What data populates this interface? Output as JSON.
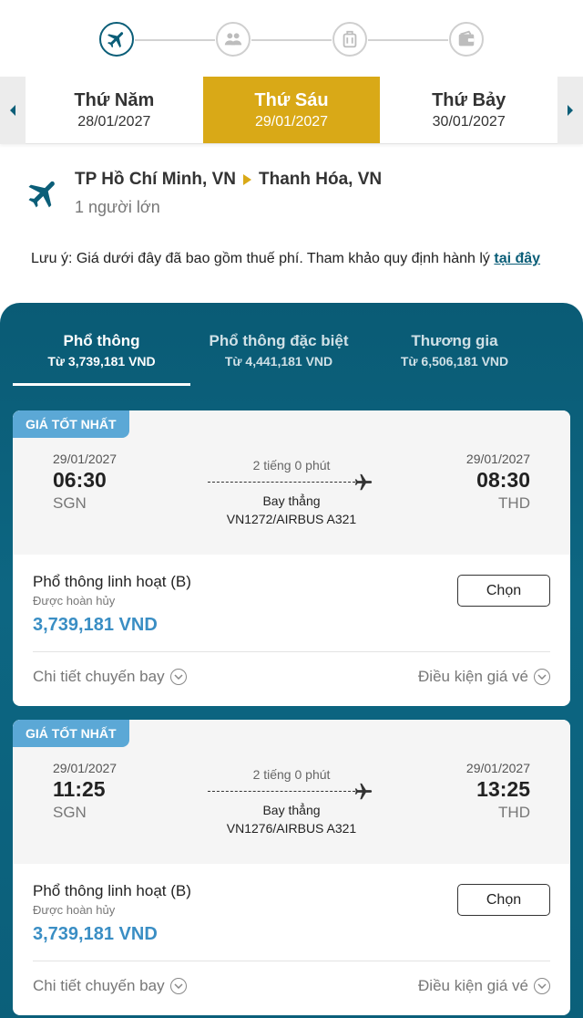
{
  "stepper": {
    "steps": [
      {
        "icon": "plane-icon",
        "state": "active"
      },
      {
        "icon": "passengers-icon",
        "state": "inactive"
      },
      {
        "icon": "baggage-icon",
        "state": "inactive"
      },
      {
        "icon": "wallet-icon",
        "state": "inactive"
      }
    ]
  },
  "dates": [
    {
      "day": "Thứ Năm",
      "date": "28/01/2027"
    },
    {
      "day": "Thứ Sáu",
      "date": "29/01/2027",
      "selected": true
    },
    {
      "day": "Thứ Bảy",
      "date": "30/01/2027"
    }
  ],
  "route": {
    "origin": "TP Hồ Chí Minh, VN",
    "destination": "Thanh Hóa, VN",
    "passengers": "1 người lớn"
  },
  "note": {
    "text": "Lưu ý: Giá dưới đây đã bao gồm thuế phí. Tham khảo quy định hành lý ",
    "link": "tại đây"
  },
  "tabs": [
    {
      "name": "Phổ thông",
      "price": "Từ 3,739,181 VND",
      "active": true
    },
    {
      "name": "Phổ thông đặc biệt",
      "price": "Từ 4,441,181 VND"
    },
    {
      "name": "Thương gia",
      "price": "Từ 6,506,181 VND"
    }
  ],
  "flights": [
    {
      "badge": "GIÁ TỐT NHẤT",
      "dep_date": "29/01/2027",
      "dep_time": "06:30",
      "dep_code": "SGN",
      "arr_date": "29/01/2027",
      "arr_time": "08:30",
      "arr_code": "THD",
      "duration": "2 tiếng 0 phút",
      "stops": "Bay thẳng",
      "flight_no": "VN1272/AIRBUS A321",
      "fare_name": "Phổ thông linh hoạt (B)",
      "refund": "Được hoàn hủy",
      "price": "3,739,181 VND",
      "button": "Chọn",
      "details": "Chi tiết chuyến bay",
      "conditions": "Điều kiện giá vé"
    },
    {
      "badge": "GIÁ TỐT NHẤT",
      "dep_date": "29/01/2027",
      "dep_time": "11:25",
      "dep_code": "SGN",
      "arr_date": "29/01/2027",
      "arr_time": "13:25",
      "arr_code": "THD",
      "duration": "2 tiếng 0 phút",
      "stops": "Bay thẳng",
      "flight_no": "VN1276/AIRBUS A321",
      "fare_name": "Phổ thông linh hoạt (B)",
      "refund": "Được hoàn hủy",
      "price": "3,739,181 VND",
      "button": "Chọn",
      "details": "Chi tiết chuyến bay",
      "conditions": "Điều kiện giá vé"
    }
  ],
  "colors": {
    "teal": "#0b5e78",
    "gold": "#d9a917",
    "price_blue": "#3a8ec4",
    "badge_blue": "#5ba8d6"
  }
}
